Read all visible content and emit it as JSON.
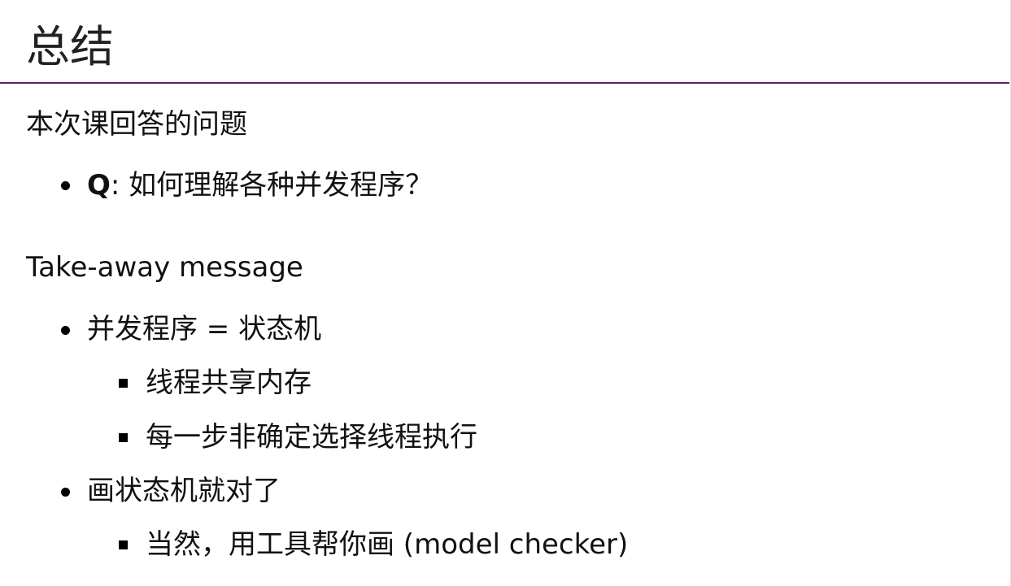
{
  "slide": {
    "title": "总结",
    "section1": {
      "heading": "本次课回答的问题",
      "items": [
        {
          "prefix": "Q",
          "text": ": 如何理解各种并发程序？"
        }
      ]
    },
    "section2": {
      "heading": "Take-away message",
      "items": [
        {
          "text": "并发程序 = 状态机",
          "subitems": [
            "线程共享内存",
            "每一步非确定选择线程执行"
          ]
        },
        {
          "text": "画状态机就对了",
          "subitems": [
            "当然，用工具帮你画 (model checker)"
          ]
        }
      ]
    }
  }
}
